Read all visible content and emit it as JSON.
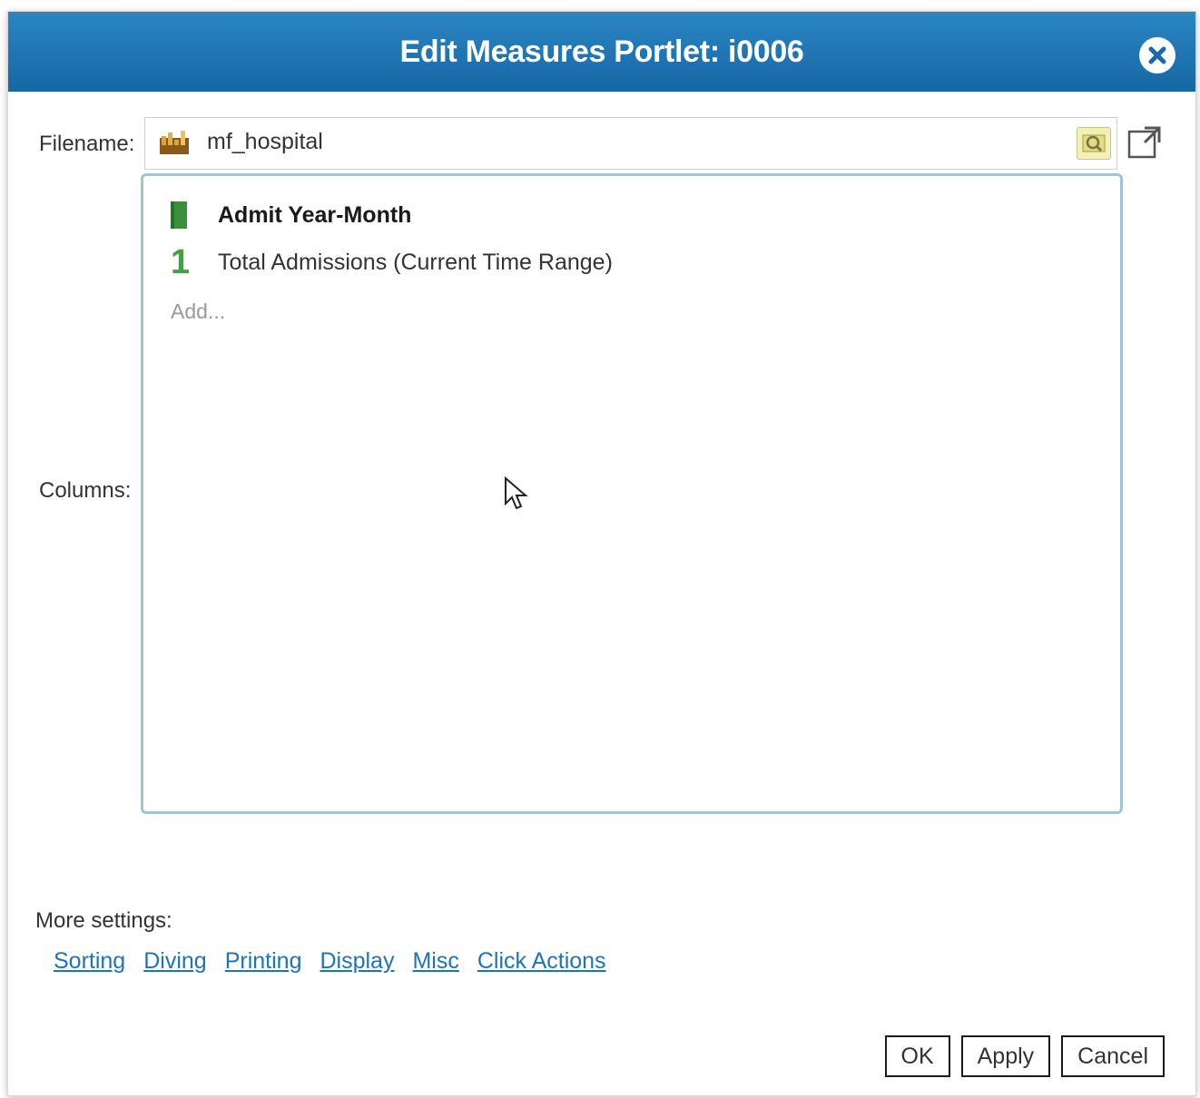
{
  "dialog": {
    "title": "Edit Measures Portlet: i0006",
    "close_icon": "close-icon"
  },
  "filename": {
    "label": "Filename:",
    "value": "mf_hospital",
    "file_icon": "chart-file-icon",
    "browse_icon": "browse-search-icon",
    "open_icon": "open-external-icon"
  },
  "columns": {
    "label": "Columns:",
    "items": [
      {
        "label": "Admit Year-Month",
        "type": "dimension",
        "icon": "dimension-icon"
      },
      {
        "label": "Total Admissions (Current Time Range)",
        "type": "measure",
        "icon_text": "1"
      }
    ],
    "add_label": "Add..."
  },
  "more_settings": {
    "label": "More settings:",
    "links": [
      "Sorting",
      "Diving",
      "Printing",
      "Display",
      "Misc",
      "Click Actions"
    ]
  },
  "buttons": {
    "ok": "OK",
    "apply": "Apply",
    "cancel": "Cancel"
  },
  "colors": {
    "titlebar": "#1f78b8",
    "link": "#1f73b7",
    "accent_green": "#3aa63a",
    "column_border": "#9fc3d9"
  }
}
